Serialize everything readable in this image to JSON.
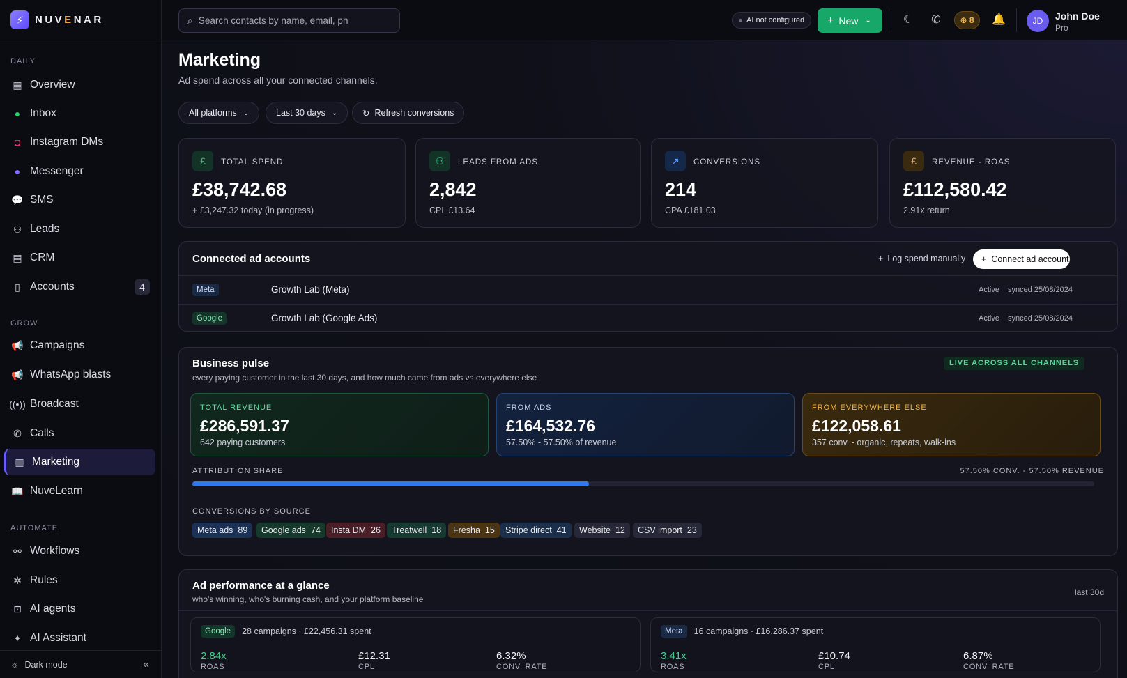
{
  "brand": {
    "name_pre": "NUV",
    "name_accent": "E",
    "name_post": "NAR"
  },
  "sidebar": {
    "sections": [
      {
        "label": "DAILY",
        "items": [
          {
            "label": "Overview",
            "icon": "grid-icon"
          },
          {
            "label": "Inbox",
            "icon": "whatsapp-icon"
          },
          {
            "label": "Instagram DMs",
            "icon": "instagram-icon"
          },
          {
            "label": "Messenger",
            "icon": "messenger-icon"
          },
          {
            "label": "SMS",
            "icon": "sms-icon"
          },
          {
            "label": "Leads",
            "icon": "users-icon"
          },
          {
            "label": "CRM",
            "icon": "briefcase-icon"
          },
          {
            "label": "Accounts",
            "icon": "phone-device-icon",
            "badge": "4"
          }
        ]
      },
      {
        "label": "GROW",
        "items": [
          {
            "label": "Campaigns",
            "icon": "megaphone-icon"
          },
          {
            "label": "WhatsApp blasts",
            "icon": "megaphone-icon"
          },
          {
            "label": "Broadcast",
            "icon": "broadcast-icon"
          },
          {
            "label": "Calls",
            "icon": "phone-icon"
          },
          {
            "label": "Marketing",
            "icon": "bar-chart-icon",
            "active": true
          },
          {
            "label": "NuveLearn",
            "icon": "book-icon"
          }
        ]
      },
      {
        "label": "AUTOMATE",
        "items": [
          {
            "label": "Workflows",
            "icon": "workflow-icon"
          },
          {
            "label": "Rules",
            "icon": "rules-icon"
          },
          {
            "label": "AI agents",
            "icon": "robot-icon"
          },
          {
            "label": "AI Assistant",
            "icon": "sparkle-icon"
          }
        ]
      }
    ],
    "footer": {
      "label": "Dark mode"
    }
  },
  "topbar": {
    "search_placeholder": "Search contacts by name, email, ph",
    "ai_status": "AI not configured",
    "new_label": "New",
    "credits": "8",
    "user": {
      "initials": "JD",
      "name": "John Doe",
      "plan": "Pro"
    }
  },
  "page": {
    "title": "Marketing",
    "subtitle": "Ad spend across all your connected channels.",
    "filters": {
      "platform": "All platforms",
      "range": "Last 30 days",
      "refresh": "Refresh conversions"
    }
  },
  "stats": [
    {
      "label": "TOTAL SPEND",
      "value": "£38,742.68",
      "sub": "+ £3,247.32 today (in progress)",
      "icon": "£",
      "color": "#2fbf7d",
      "bg": "#123326"
    },
    {
      "label": "LEADS FROM ADS",
      "value": "2,842",
      "sub": "CPL £13.64",
      "icon": "👥",
      "color": "#2fbf7d",
      "bg": "#123326"
    },
    {
      "label": "CONVERSIONS",
      "value": "214",
      "sub": "CPA £181.03",
      "icon": "↗",
      "color": "#5a9bff",
      "bg": "#15284a"
    },
    {
      "label": "REVENUE - ROAS",
      "value": "£112,580.42",
      "sub": "2.91x return",
      "icon": "£",
      "color": "#f0a63a",
      "bg": "#3a2a10"
    }
  ],
  "accounts": {
    "title": "Connected ad accounts",
    "log_label": "Log spend manually",
    "connect_label": "Connect ad account",
    "rows": [
      {
        "platform": "Meta",
        "name": "Growth Lab (Meta)",
        "status": "Active",
        "synced": "synced 25/08/2024"
      },
      {
        "platform": "Google",
        "name": "Growth Lab (Google Ads)",
        "status": "Active",
        "synced": "synced 25/08/2024"
      }
    ]
  },
  "pulse": {
    "title": "Business pulse",
    "subtitle": "every paying customer in the last 30 days, and how much came from ads vs everywhere else",
    "badge": "LIVE ACROSS ALL CHANNELS",
    "boxes": [
      {
        "label": "TOTAL REVENUE",
        "value": "£286,591.37",
        "sub": "642 paying customers"
      },
      {
        "label": "FROM ADS",
        "value": "£164,532.76",
        "sub": "57.50% - 57.50% of revenue"
      },
      {
        "label": "FROM EVERYWHERE ELSE",
        "value": "£122,058.61",
        "sub": "357 conv. - organic, repeats, walk-ins"
      }
    ],
    "attribution_label": "ATTRIBUTION SHARE",
    "attribution_right": "57.50% CONV. - 57.50% REVENUE",
    "attribution_fill": 0.44,
    "sources_label": "CONVERSIONS BY SOURCE",
    "sources": [
      {
        "name": "Meta ads",
        "count": "89",
        "bg": "#1b3256"
      },
      {
        "name": "Google ads",
        "count": "74",
        "bg": "#153a2b"
      },
      {
        "name": "Insta DM",
        "count": "26",
        "bg": "#4a1e26"
      },
      {
        "name": "Treatwell",
        "count": "18",
        "bg": "#163a30"
      },
      {
        "name": "Fresha",
        "count": "15",
        "bg": "#4a3412"
      },
      {
        "name": "Stripe direct",
        "count": "41",
        "bg": "#1b2f4a"
      },
      {
        "name": "Website",
        "count": "12",
        "bg": "#262838"
      },
      {
        "name": "CSV import",
        "count": "23",
        "bg": "#262838"
      }
    ]
  },
  "performance": {
    "title": "Ad performance at a glance",
    "subtitle": "who's winning, who's burning cash, and your platform baseline",
    "period": "last 30d",
    "platforms": [
      {
        "platform": "Google",
        "summary": "28 campaigns · £22,456.31 spent",
        "roas": "2.84x",
        "cpl": "£12.31",
        "conv_rate": "6.32%"
      },
      {
        "platform": "Meta",
        "summary": "16 campaigns · £16,286.37 spent",
        "roas": "3.41x",
        "cpl": "£10.74",
        "conv_rate": "6.87%"
      }
    ],
    "labels": {
      "roas": "ROAS",
      "cpl": "CPL",
      "conv_rate": "CONV. RATE"
    }
  }
}
